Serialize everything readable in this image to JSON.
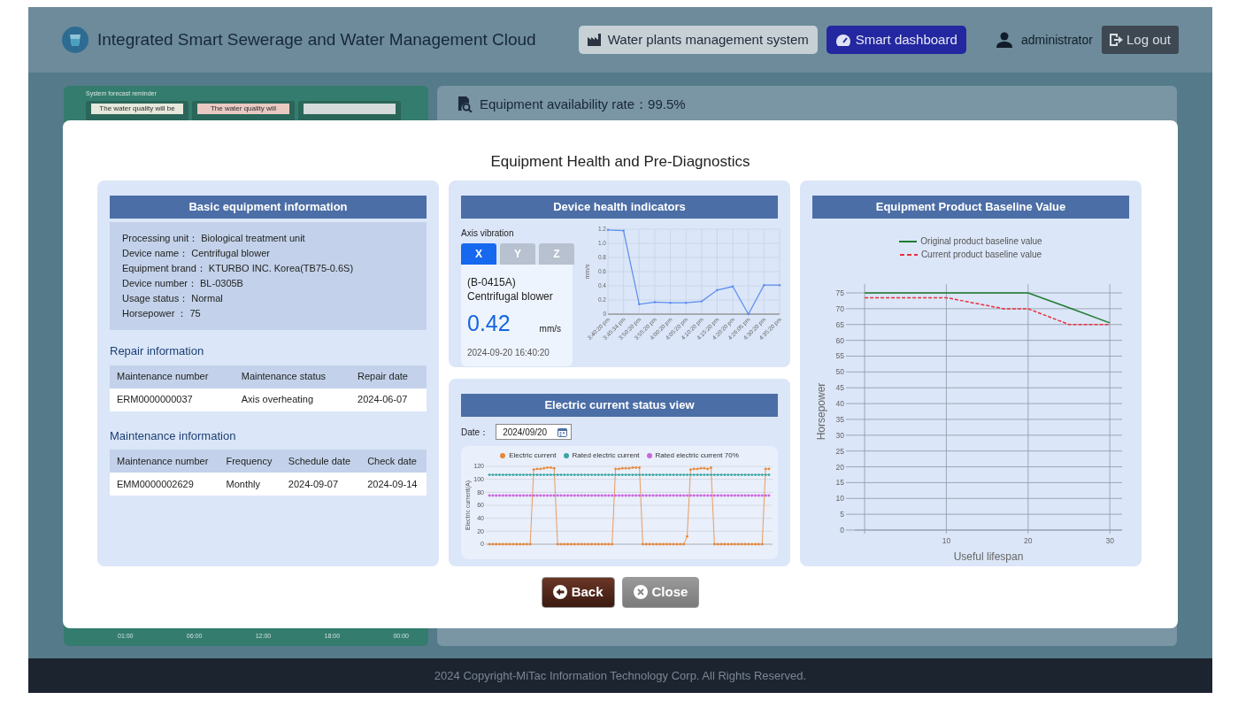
{
  "header": {
    "title": "Integrated Smart Sewerage and Water Management Cloud",
    "nav": [
      {
        "label": "Water plants management system",
        "kind": "plants",
        "selected": false
      },
      {
        "label": "Smart dashboard",
        "kind": "dashboard",
        "selected": true
      }
    ],
    "user": "administrator",
    "logout": "Log out"
  },
  "background": {
    "forecast_title": "System forecast reminder",
    "forecast_cards": [
      {
        "text": "The water quality will be",
        "color": "#e6e8dc"
      },
      {
        "text": "The water quality will",
        "color": "#e9c9c2"
      },
      {
        "color": "#d5dadb"
      }
    ],
    "availability": "Equipment availability rate：99.5%",
    "time_axis": [
      "01:00",
      "06:00",
      "12:00",
      "18:00",
      "00:00"
    ]
  },
  "modal": {
    "title": "Equipment Health and Pre-Diagnostics",
    "basic": {
      "heading": "Basic equipment information",
      "fields": [
        {
          "label": "Processing unit：",
          "value": "Biological treatment unit"
        },
        {
          "label": "Device name：",
          "value": "Centrifugal blower"
        },
        {
          "label": "Equipment brand：",
          "value": "KTURBO INC. Korea(TB75-0.6S)"
        },
        {
          "label": "Device number：",
          "value": "BL-0305B"
        },
        {
          "label": "Usage status：",
          "value": "Normal"
        },
        {
          "label": "Horsepower ：",
          "value": "75"
        }
      ],
      "repair": {
        "heading": "Repair information",
        "columns": [
          "Maintenance number",
          "Maintenance status",
          "Repair date"
        ],
        "rows": [
          [
            "ERM0000000037",
            "Axis overheating",
            "2024-06-07"
          ]
        ]
      },
      "maintenance": {
        "heading": "Maintenance information",
        "columns": [
          "Maintenance number",
          "Frequency",
          "Schedule date",
          "Check date"
        ],
        "rows": [
          [
            "EMM0000002629",
            "Monthly",
            "2024-09-07",
            "2024-09-14"
          ]
        ]
      }
    },
    "health": {
      "heading": "Device health indicators",
      "label": "Axis vibration",
      "axes": [
        {
          "label": "X",
          "selected": true
        },
        {
          "label": "Y",
          "selected": false
        },
        {
          "label": "Z",
          "selected": false
        }
      ],
      "device_code": "(B-0415A)",
      "device_name": "Centrifugal blower",
      "value": "0.42",
      "unit": "mm/s",
      "timestamp": "2024-09-20 16:40:20",
      "chart_data": {
        "type": "line",
        "ylabel": "mm/s",
        "categories": [
          "3:40:20 pm",
          "3:45:34 pm",
          "3:50:20 pm",
          "3:55:20 pm",
          "4:00:20 pm",
          "4:05:20 pm",
          "4:10:20 pm",
          "4:15:20 pm",
          "4:20:20 pm",
          "4:26:05 pm",
          "4:30:20 pm",
          "4:35:20 pm"
        ],
        "grid": true,
        "ylim": [
          0,
          1.2
        ],
        "yticks": [
          0,
          0.2,
          0.4,
          0.6,
          0.8,
          {
            "value": 1,
            "label": "1.0"
          },
          1.2
        ],
        "series": [
          {
            "color": "#5b8def",
            "line_style": "solid",
            "values": [
              1.19,
              1.18,
              0.14,
              0.17,
              0.16,
              0.16,
              0.18,
              0.34,
              0.39,
              0.0,
              0.41,
              0.41
            ]
          }
        ]
      }
    },
    "current": {
      "heading": "Electric current status view",
      "date_label": "Date：",
      "date": "2024/09/20",
      "chart_data": {
        "type": "line",
        "ylabel": "Electric current(A)",
        "grid": true,
        "ylim": [
          0,
          120
        ],
        "yticks": [
          0,
          20,
          40,
          60,
          80,
          100,
          120
        ],
        "series": [
          {
            "name": "Electric current",
            "color": "#e8883a",
            "line_style": "solid",
            "values": [
              0,
              0,
              0,
              0,
              0,
              0,
              0,
              0,
              0,
              0,
              0,
              0,
              0,
              115,
              116,
              116,
              117,
              118,
              118,
              117,
              0,
              0,
              0,
              0,
              0,
              0,
              0,
              0,
              0,
              0,
              0,
              0,
              0,
              0,
              0,
              0,
              0,
              116,
              116,
              117,
              117,
              117,
              118,
              118,
              118,
              0,
              0,
              0,
              0,
              0,
              0,
              0,
              0,
              0,
              0,
              0,
              0,
              0,
              12,
              115,
              116,
              116,
              117,
              117,
              116,
              118,
              0,
              0,
              0,
              0,
              0,
              0,
              0,
              0,
              0,
              0,
              0,
              0,
              0,
              0,
              0,
              116,
              116
            ]
          },
          {
            "name": "Rated electric current",
            "color": "#3aa5a0",
            "line_style": "solid",
            "values": [
              107,
              107,
              107,
              107,
              107,
              107,
              107,
              107,
              107,
              107,
              107,
              107,
              107,
              107,
              107,
              107,
              107,
              107,
              107,
              107,
              107,
              107,
              107,
              107,
              107,
              107,
              107,
              107,
              107,
              107,
              107,
              107,
              107,
              107,
              107,
              107,
              107,
              107,
              107,
              107,
              107,
              107,
              107,
              107,
              107,
              107,
              107,
              107,
              107,
              107,
              107,
              107,
              107,
              107,
              107,
              107,
              107,
              107,
              107,
              107,
              107,
              107,
              107,
              107,
              107,
              107,
              107,
              107,
              107,
              107,
              107,
              107,
              107,
              107,
              107,
              107,
              107,
              107,
              107,
              107,
              107,
              107,
              107
            ]
          },
          {
            "name": "Rated electric current 70%",
            "color": "#cc66dd",
            "line_style": "solid",
            "values": [
              75,
              75,
              75,
              75,
              75,
              75,
              75,
              75,
              75,
              75,
              75,
              75,
              75,
              75,
              75,
              75,
              75,
              75,
              75,
              75,
              75,
              75,
              75,
              75,
              75,
              75,
              75,
              75,
              75,
              75,
              75,
              75,
              75,
              75,
              75,
              75,
              75,
              75,
              75,
              75,
              75,
              75,
              75,
              75,
              75,
              75,
              75,
              75,
              75,
              75,
              75,
              75,
              75,
              75,
              75,
              75,
              75,
              75,
              75,
              75,
              75,
              75,
              75,
              75,
              75,
              75,
              75,
              75,
              75,
              75,
              75,
              75,
              75,
              75,
              75,
              75,
              75,
              75,
              75,
              75,
              75,
              75,
              75
            ]
          }
        ]
      }
    },
    "baseline": {
      "heading": "Equipment Product Baseline Value",
      "chart_data": {
        "type": "line",
        "xlabel": "Useful lifespan",
        "ylabel": "Horsepower",
        "x": [
          0,
          10,
          17,
          20,
          25,
          30
        ],
        "grid": true,
        "xlim": [
          -1.2,
          31.5
        ],
        "ylim": [
          0,
          75
        ],
        "xticks": [
          10,
          20,
          30
        ],
        "yticks": [
          0,
          5,
          10,
          15,
          20,
          25,
          30,
          35,
          40,
          45,
          50,
          55,
          60,
          65,
          70,
          75
        ],
        "series": [
          {
            "name": "Original product baseline value",
            "color": "#1e7a2e",
            "line_style": "solid",
            "values": [
              75,
              75,
              75,
              75,
              70.3,
              65.5
            ]
          },
          {
            "name": "Current product baseline value",
            "color": "#e8323c",
            "line_style": "dashed",
            "values": [
              73.5,
              73.5,
              70,
              70,
              65,
              65
            ]
          }
        ]
      }
    },
    "buttons": [
      {
        "label": "Back",
        "kind": "back"
      },
      {
        "label": "Close",
        "kind": "close"
      }
    ]
  },
  "footer": "2024 Copyright-MiTac Information Technology Corp. All Rights Reserved."
}
